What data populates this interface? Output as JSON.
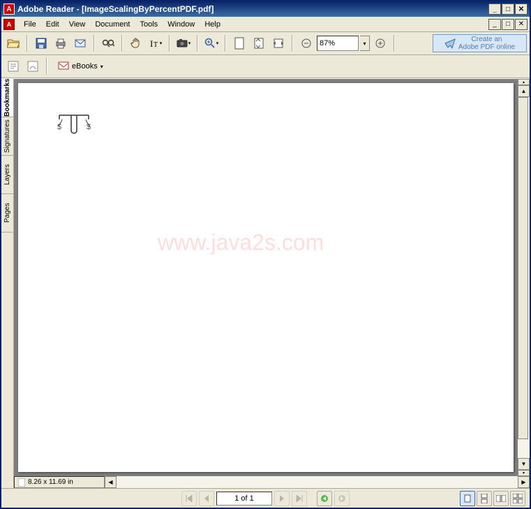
{
  "window": {
    "title": "Adobe Reader - [ImageScalingByPercentPDF.pdf]"
  },
  "menu": {
    "file": "File",
    "edit": "Edit",
    "view": "View",
    "document": "Document",
    "tools": "Tools",
    "window": "Window",
    "help": "Help"
  },
  "toolbar": {
    "zoom_value": "87%",
    "create_pdf_line1": "Create an",
    "create_pdf_line2": "Adobe PDF online"
  },
  "toolbar2": {
    "ebooks_label": "eBooks"
  },
  "nav_tabs": {
    "bookmarks": "Bookmarks",
    "signatures": "Signatures",
    "layers": "Layers",
    "pages": "Pages"
  },
  "document": {
    "watermark": "www.java2s.com",
    "page_dimensions": "8.26 x 11.69 in"
  },
  "statusbar": {
    "page_indicator": "1 of 1"
  }
}
